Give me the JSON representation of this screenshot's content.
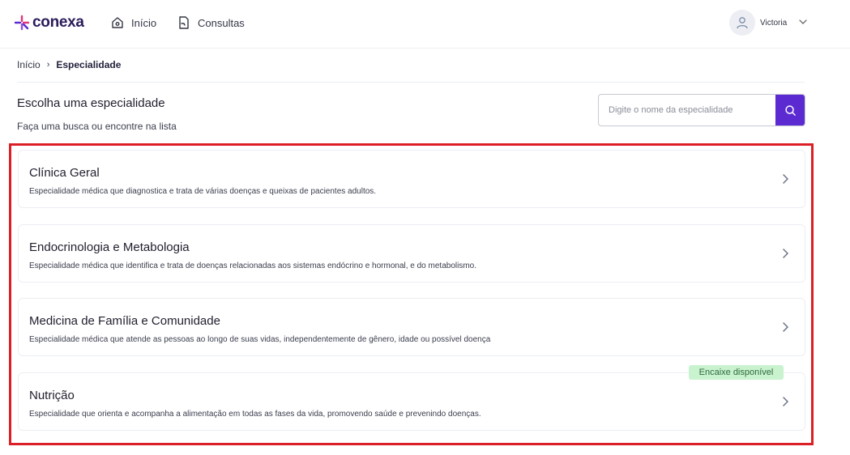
{
  "header": {
    "brand": "conexa",
    "nav": [
      {
        "label": "Início",
        "icon": "home-icon"
      },
      {
        "label": "Consultas",
        "icon": "document-icon"
      }
    ],
    "user": {
      "name": "Victoria",
      "avatar_icon": "user-icon"
    }
  },
  "breadcrumb": {
    "items": [
      "Início",
      "Especialidade"
    ]
  },
  "page": {
    "title": "Escolha uma especialidade",
    "subtitle": "Faça uma busca ou encontre na lista"
  },
  "search": {
    "placeholder": "Digite o nome da especialidade",
    "button_icon": "search-icon"
  },
  "specialties": [
    {
      "title": "Clínica Geral",
      "description": "Especialidade médica que diagnostica e trata de várias doenças e queixas de pacientes adultos."
    },
    {
      "title": "Endocrinologia e Metabologia",
      "description": "Especialidade médica que identifica e trata de doenças relacionadas aos sistemas endócrino e hormonal, e do metabolismo."
    },
    {
      "title": "Medicina de Família e Comunidade",
      "description": "Especialidade médica que atende as pessoas ao longo de suas vidas, independentemente de gênero, idade ou possível doença"
    },
    {
      "title": "Nutrição",
      "description": "Especialidade que orienta e acompanha a alimentação em todas as fases da vida, promovendo saúde e prevenindo doenças.",
      "badge": "Encaixe disponível"
    }
  ],
  "colors": {
    "brand_purple": "#5b2ad1",
    "highlight_red": "#dc1f26",
    "badge_green": "#c9f2cf"
  }
}
